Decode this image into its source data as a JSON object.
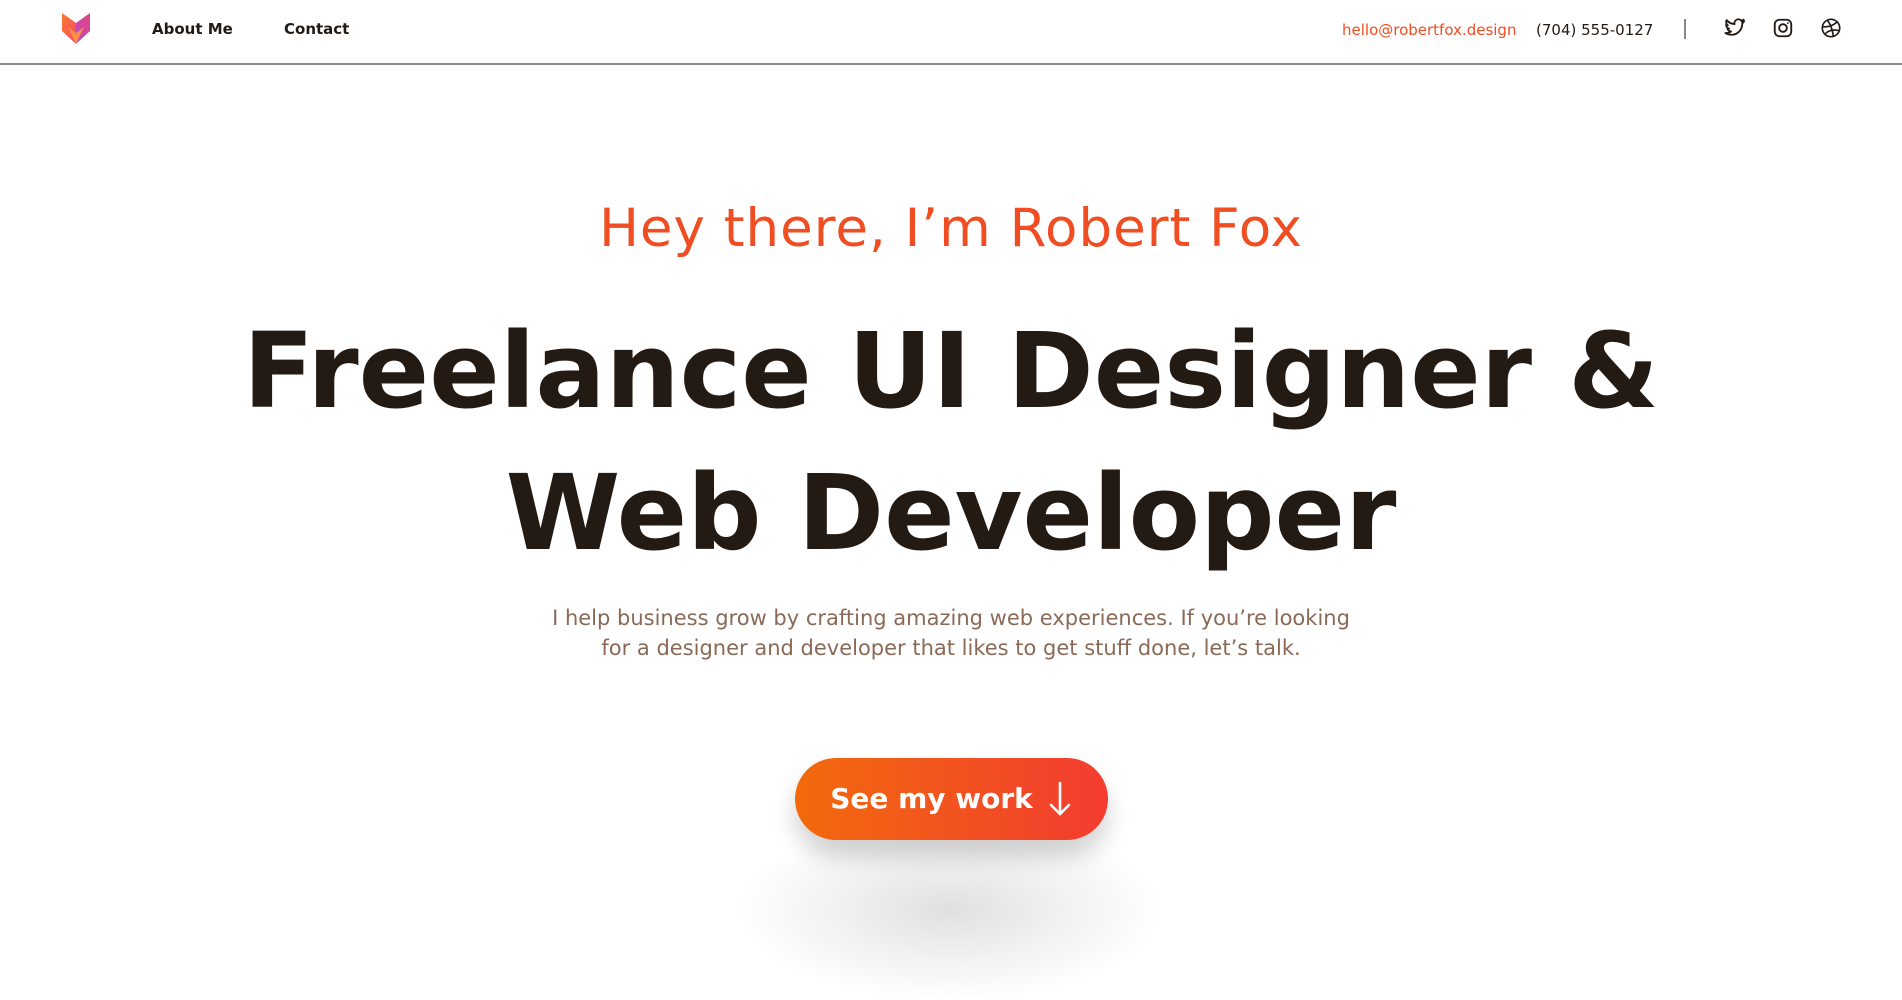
{
  "nav": {
    "about_label": "About Me",
    "contact_label": "Contact"
  },
  "contact": {
    "email": "hello@robertfox.design",
    "phone": "(704) 555-0127"
  },
  "social": {
    "icons": [
      "twitter-icon",
      "instagram-icon",
      "dribbble-icon"
    ]
  },
  "hero": {
    "greeting": "Hey there, I’m Robert Fox",
    "title_line1": "Freelance UI Designer &",
    "title_line2": "Web Developer",
    "sub_line1": "I help business grow by crafting amazing web experiences. If you’re looking",
    "sub_line2": "for a designer and developer that likes to get stuff done, let’s talk.",
    "cta_label": "See my work"
  },
  "colors": {
    "accent": "#f04d22",
    "heading": "#231a14",
    "body_text": "#8a6a57",
    "button_gradient_start": "#f26a0c",
    "button_gradient_end": "#f43b30"
  }
}
